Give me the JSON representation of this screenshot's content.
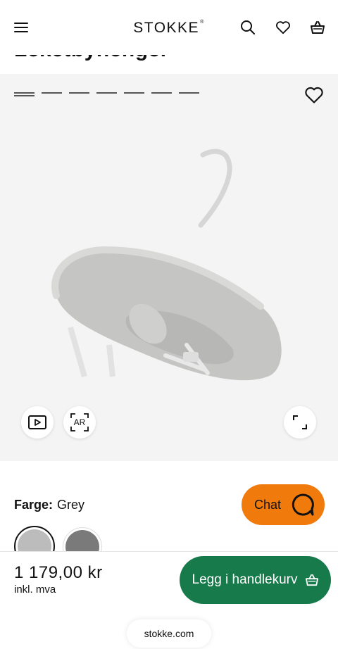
{
  "header": {
    "brand": "STOKKE",
    "brand_mark": "®",
    "icons": [
      "menu-icon",
      "search-icon",
      "heart-icon",
      "basket-icon"
    ]
  },
  "product": {
    "title_cut": "Leketbyhenger"
  },
  "gallery": {
    "ar_label": "AR",
    "slides_count": 7,
    "active_slide": 1
  },
  "color": {
    "label": "Farge:",
    "value": "Grey",
    "swatches": [
      {
        "name": "Grey",
        "hex": "#bcbcbc",
        "selected": true
      },
      {
        "name": "Dark grey",
        "hex": "#7a7a7a",
        "selected": false
      }
    ]
  },
  "chat": {
    "label": "Chat",
    "color": "#f07b0c"
  },
  "purchase": {
    "price": "1 179,00 kr",
    "vat": "inkl. mva",
    "cart_label": "Legg i handlekurv",
    "cart_color": "#167a4b"
  },
  "browser": {
    "url": "stokke.com"
  }
}
